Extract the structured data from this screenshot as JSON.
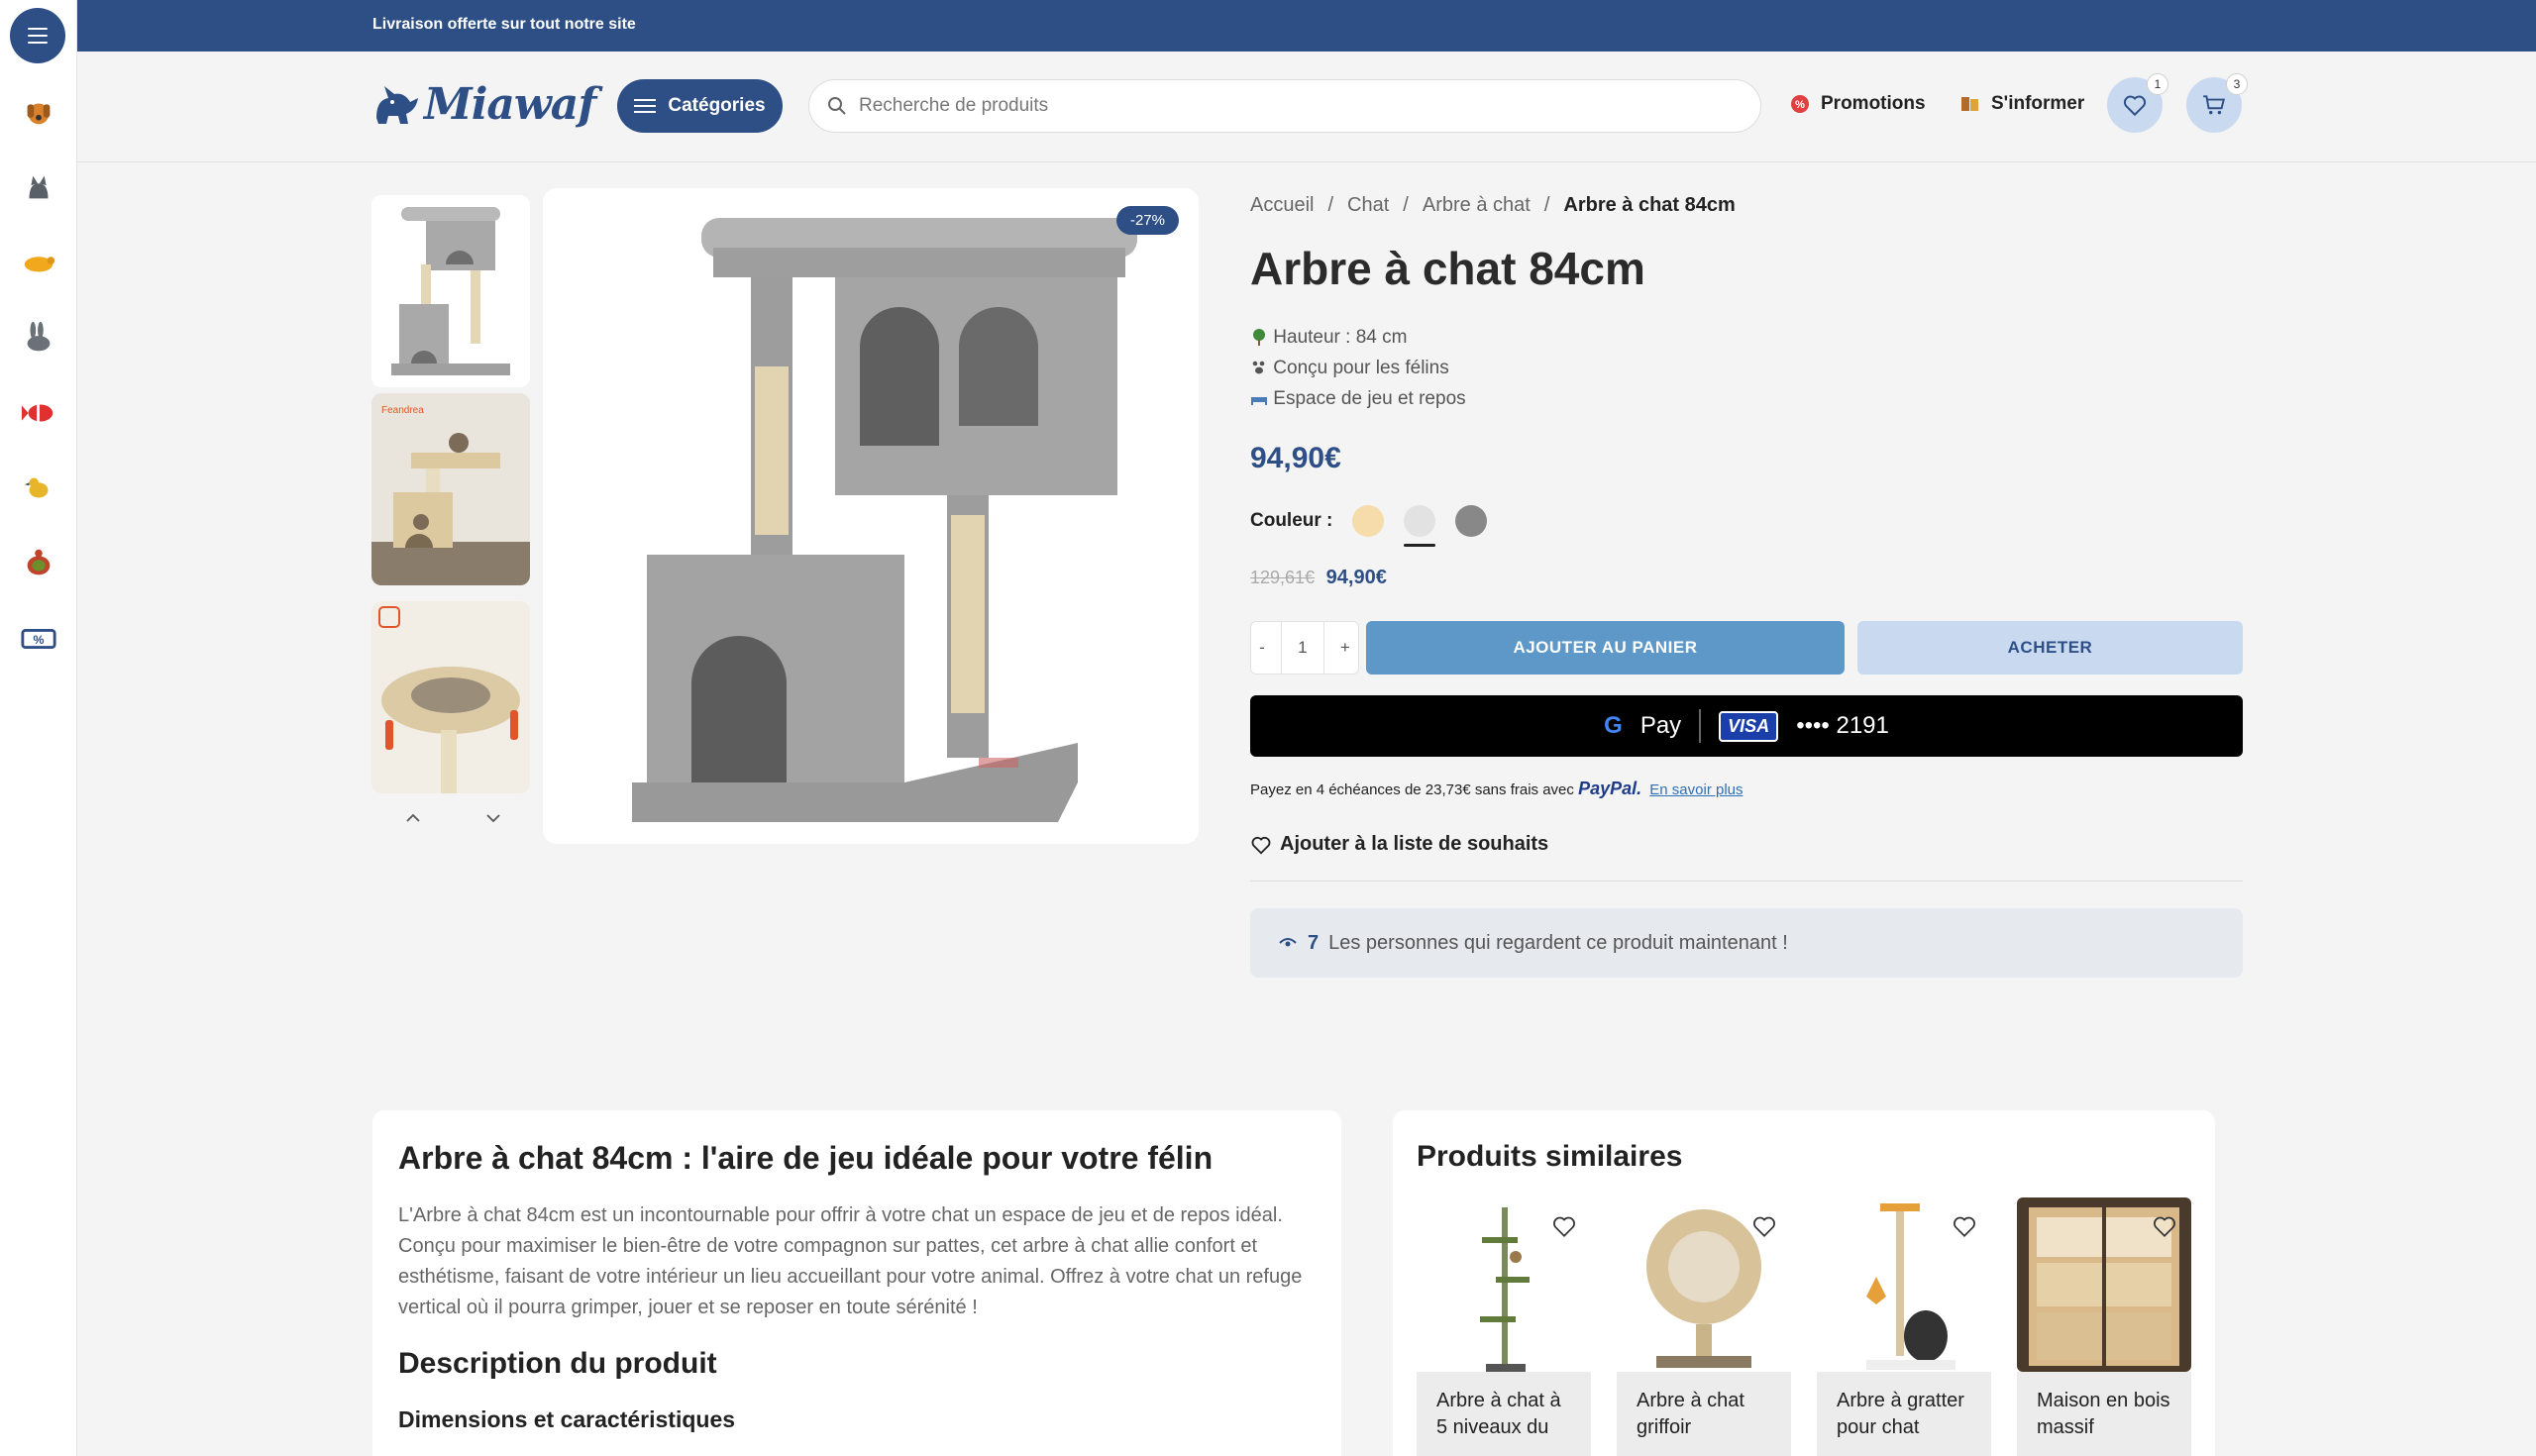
{
  "banner": {
    "text": "Livraison offerte sur tout notre site"
  },
  "header": {
    "logo_text": "Miawaf",
    "categories_label": "Catégories",
    "search_placeholder": "Recherche de produits",
    "promotions_label": "Promotions",
    "inform_label": "S'informer",
    "wishlist_count": "1",
    "cart_count": "3"
  },
  "rail": {
    "icons": [
      "dog-icon",
      "cat-icon",
      "rodent-icon",
      "rabbit-icon",
      "fish-icon",
      "bird-icon",
      "turtle-icon",
      "promo-ticket-icon"
    ]
  },
  "gallery": {
    "discount_badge": "-27%"
  },
  "product": {
    "breadcrumb": [
      "Accueil",
      "Chat",
      "Arbre à chat",
      "Arbre à chat 84cm"
    ],
    "title": "Arbre à chat 84cm",
    "features": [
      "Hauteur : 84 cm",
      "Conçu pour les félins",
      "Espace de jeu et repos"
    ],
    "price": "94,90€",
    "color_label": "Couleur :",
    "colors": [
      "#f6dcaa",
      "#e2e2e2",
      "#888888"
    ],
    "selected_color": 1,
    "old_price": "129,61€",
    "new_price": "94,90€",
    "quantity": "1",
    "qty_minus": "-",
    "qty_plus": "+",
    "add_to_cart": "AJOUTER AU PANIER",
    "buy": "ACHETER",
    "gpay_label": "Pay",
    "card_brand": "VISA",
    "card_number": "•••• 2191",
    "paypal_text": "Payez en 4 échéances de 23,73€ sans frais avec",
    "paypal_brand": "PayPal.",
    "paypal_link": "En savoir plus",
    "wishlist_label": "Ajouter à la liste de souhaits",
    "watchers_count": "7",
    "watchers_text": "Les personnes qui regardent ce produit maintenant !"
  },
  "description": {
    "heading": "Arbre à chat 84cm : l'aire de jeu idéale pour votre félin",
    "paragraph": "L'Arbre à chat 84cm est un incontournable pour offrir à votre chat un espace de jeu et de repos idéal. Conçu pour maximiser le bien-être de votre compagnon sur pattes, cet arbre à chat allie confort et esthétisme, faisant de votre intérieur un lieu accueillant pour votre animal. Offrez à votre chat un refuge vertical où il pourra grimper, jouer et se reposer en toute sérénité !",
    "subheading": "Description du produit",
    "subsubheading": "Dimensions et caractéristiques"
  },
  "similar": {
    "heading": "Produits similaires",
    "items": [
      {
        "name": "Arbre à chat à 5 niveaux du"
      },
      {
        "name": "Arbre à chat griffoir"
      },
      {
        "name": "Arbre à gratter pour chat"
      },
      {
        "name": "Maison en bois massif"
      }
    ]
  }
}
